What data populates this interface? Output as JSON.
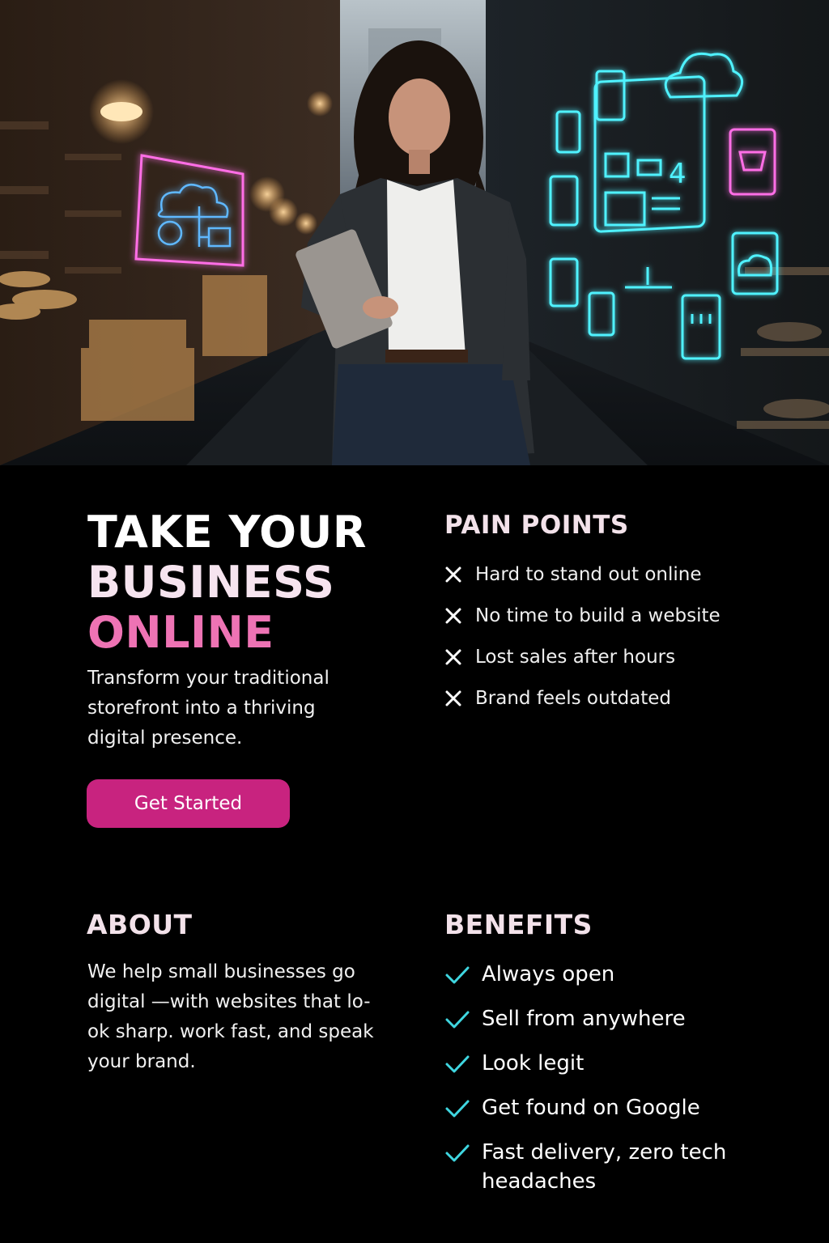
{
  "hero": {
    "monitor_number": "4"
  },
  "headline": {
    "line1": "TAKE YOUR",
    "line2": "BUSINESS",
    "line3": "ONLINE"
  },
  "subtitle": "Transform your traditional storefront into a thriving digital presence.",
  "cta": {
    "label": "Get Started"
  },
  "pain_points": {
    "title": "PAIN POINTS",
    "items": [
      "Hard to stand out online",
      "No time to build a website",
      "Lost sales after hours",
      "Brand feels outdated"
    ]
  },
  "about": {
    "title": "ABOUT",
    "text": "We help small businesses go digital —with websites that lo-ok sharp. work fast, and speak your brand."
  },
  "benefits": {
    "title": "BENEFITS",
    "items": [
      "Always open",
      "Sell from anywhere",
      "Look legit",
      "Get found on Google",
      "Fast delivery, zero tech headaches"
    ]
  },
  "colors": {
    "background": "#000000",
    "accent_pink": "#ee73b4",
    "button": "#c8237f",
    "check_cyan": "#3fd6e0",
    "neon_pink": "#ff4fd8",
    "neon_cyan": "#4ff2ff"
  }
}
